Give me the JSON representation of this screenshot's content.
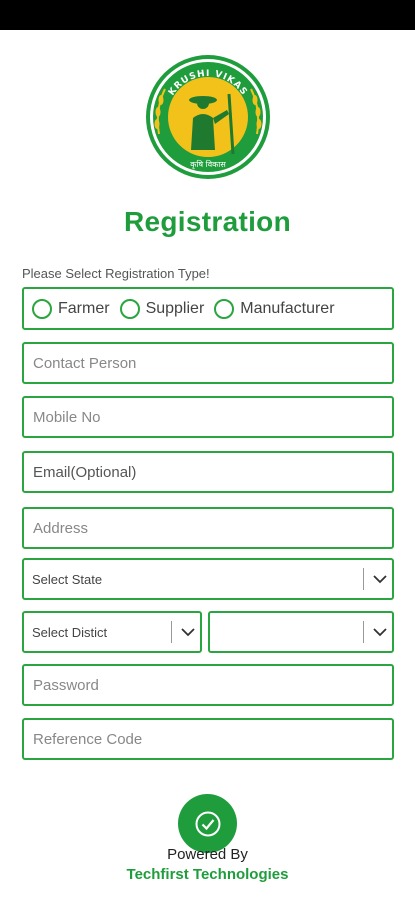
{
  "logo": {
    "top_text": "KRUSHI VIKAS",
    "bottom_text": "कृषि विकास",
    "colors": {
      "ring": "#1f9d3c",
      "inner": "#f3c21a",
      "figure": "#1f7a2f"
    }
  },
  "page_title": "Registration",
  "registration_type": {
    "label": "Please Select Registration Type!",
    "options": [
      "Farmer",
      "Supplier",
      "Manufacturer"
    ]
  },
  "fields": {
    "contact_person": "Contact Person",
    "mobile_no": "Mobile No",
    "email": "Email(Optional)",
    "address": "Address",
    "password": "Password",
    "reference_code": "Reference Code"
  },
  "selects": {
    "state": "Select State",
    "district": "Select Distict",
    "taluka": ""
  },
  "submit": {
    "icon": "check-circle-icon"
  },
  "footer": {
    "powered_by": "Powered By",
    "company": "Techfirst Technologies"
  },
  "colors": {
    "accent": "#1f9d3c",
    "border": "#2aa53f"
  }
}
